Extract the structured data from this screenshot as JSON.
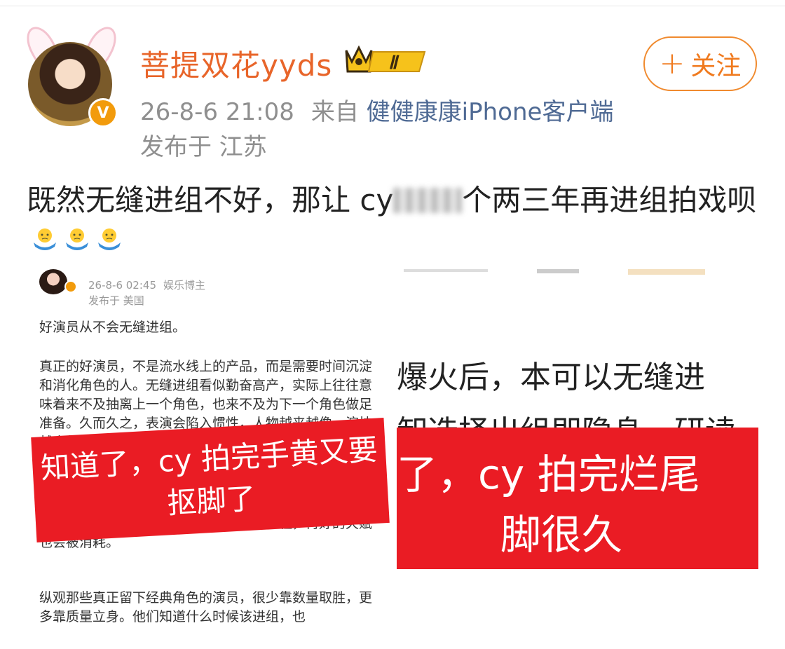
{
  "post": {
    "username": "菩提双花yyds",
    "level_badge": "Ⅱ",
    "follow_label": "关注",
    "follow_icon": "plus-icon",
    "timestamp": "26-8-6 21:08",
    "source_prefix": "来自",
    "source": "健健康康iPhone客户端",
    "location": "发布于 江苏",
    "text_before": "既然无缝进组不好，那让 cy",
    "text_after": "个两三年再进组拍戏呗",
    "emoji": "shrug-emoji",
    "colors": {
      "username": "#e8652a",
      "follow": "#f07a1e",
      "source": "#4f6a94",
      "banner": "#ea1c24"
    }
  },
  "left_image": {
    "timestamp": "26-8-6 02:45",
    "tag": "娱乐博主",
    "location": "发布于 美国",
    "paragraphs": [
      "好演员从不会无缝进组。",
      "真正的好演员，不是流水线上的产品，而是需要时间沉淀和消化角色的人。无缝进组看似勤奋高产，实际上往往意味着来不及抽离上一个角色，也来不及为下一个角色做足准备。久而久之，表演会陷入惯性，人物越来越像，演技越来越模式化。",
      "需要对表演进行复盘和沉淀。没有这些过程，再好的天赋也会被消耗。",
      "纵观那些真正留下经典角色的演员，很少靠数量取胜，更多靠质量立身。他们知道什么时候该进组，也"
    ],
    "banner": {
      "line1": "知道了，cy 拍完手黄又要",
      "line2": "抠脚了"
    }
  },
  "right_image": {
    "line1": "爆火后，本可以无缝进",
    "line2": "卸选择出组即隐身，研读",
    "banner": {
      "line1": "了，cy 拍完烂尾",
      "line2": "脚很久"
    }
  }
}
